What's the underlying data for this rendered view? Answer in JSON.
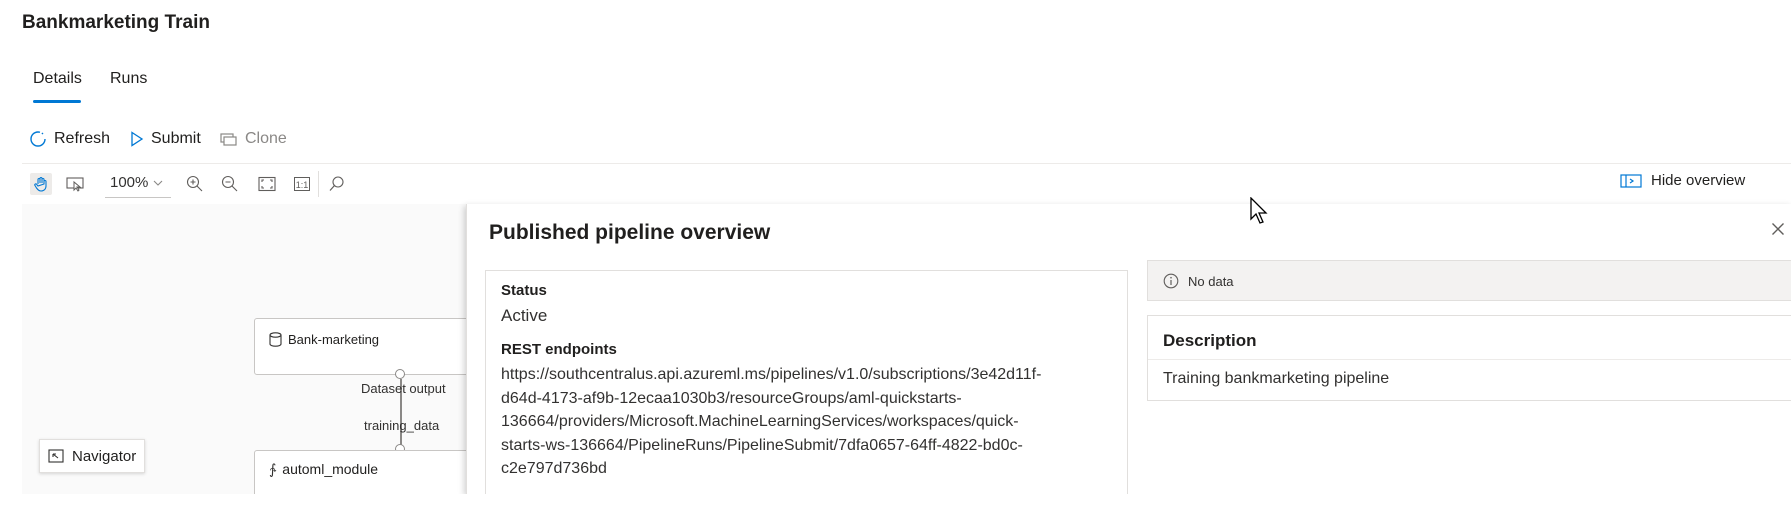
{
  "page": {
    "title": "Bankmarketing Train"
  },
  "tabs": [
    {
      "label": "Details",
      "active": true
    },
    {
      "label": "Runs",
      "active": false
    }
  ],
  "commands": {
    "refresh": "Refresh",
    "submit": "Submit",
    "clone": "Clone"
  },
  "toolbar": {
    "zoom": "100%",
    "actual_size": "1:1",
    "hide_overview": "Hide overview"
  },
  "canvas": {
    "dataset_node": "Bank-marketing",
    "dataset_output": "Dataset output",
    "training_data": "training_data",
    "module_node": "automl_module",
    "navigator": "Navigator"
  },
  "panel": {
    "title": "Published pipeline overview",
    "status_label": "Status",
    "status_value": "Active",
    "rest_label": "REST endpoints",
    "rest_lines": [
      "https://southcentralus.api.azureml.ms/pipelines/v1.0/subscriptions/3e42d11f-",
      "d64d-4173-af9b-12ecaa1030b3/resourceGroups/aml-quickstarts-",
      "136664/providers/Microsoft.MachineLearningServices/workspaces/quick-",
      "starts-ws-136664/PipelineRuns/PipelineSubmit/7dfa0657-64ff-4822-bd0c-",
      "c2e797d736bd"
    ],
    "no_data": "No data",
    "description_label": "Description",
    "description_value": "Training bankmarketing pipeline"
  },
  "colors": {
    "accent": "#0078d4",
    "text": "#201f1e",
    "muted": "#8a8886"
  }
}
